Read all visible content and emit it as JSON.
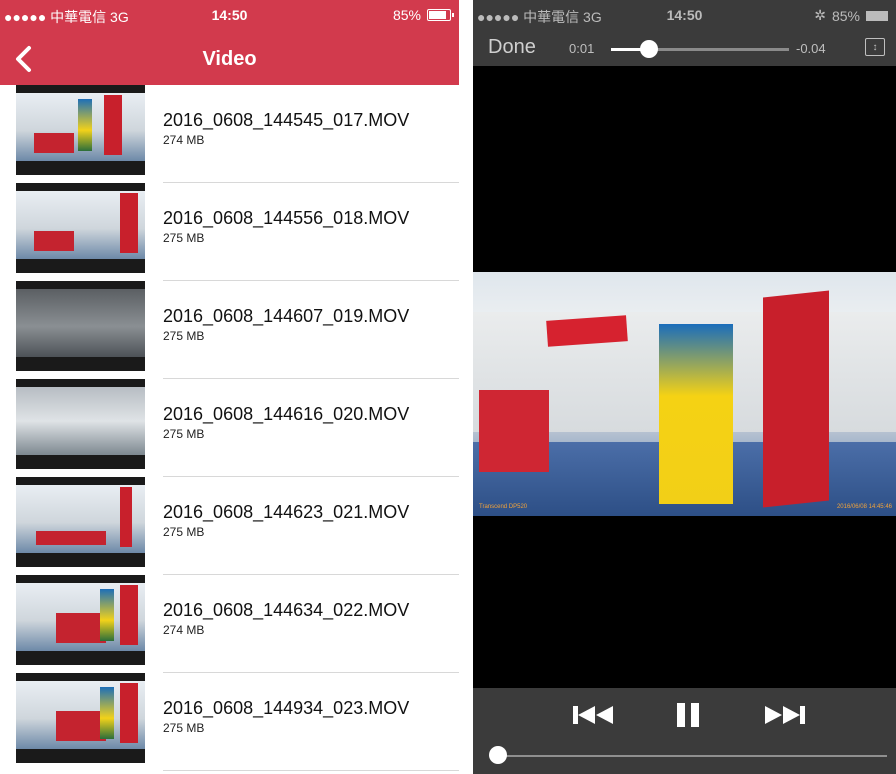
{
  "left": {
    "status_bar": {
      "carrier": "●●●●● 中華電信  3G",
      "time": "14:50",
      "battery": "85%"
    },
    "nav": {
      "title": "Video"
    },
    "videos": [
      {
        "name": "2016_0608_144545_017.MOV",
        "size": "274 MB"
      },
      {
        "name": "2016_0608_144556_018.MOV",
        "size": "275 MB"
      },
      {
        "name": "2016_0608_144607_019.MOV",
        "size": "275 MB"
      },
      {
        "name": "2016_0608_144616_020.MOV",
        "size": "275 MB"
      },
      {
        "name": "2016_0608_144623_021.MOV",
        "size": "275 MB"
      },
      {
        "name": "2016_0608_144634_022.MOV",
        "size": "274 MB"
      },
      {
        "name": "2016_0608_144934_023.MOV",
        "size": "275 MB"
      }
    ]
  },
  "right": {
    "status_bar": {
      "carrier": "●●●●● 中華電信  3G",
      "time": "14:50",
      "battery": "85%"
    },
    "top": {
      "done_label": "Done",
      "elapsed": "0:01",
      "remaining": "-0.04",
      "scrub_progress": 0.2
    },
    "video": {
      "stamp_left": "Transcend DP520",
      "stamp_right": "2016/06/08 14:45:46"
    },
    "controls": {
      "volume_level": 0.02
    },
    "colors": {
      "navbar": "#d23a4d",
      "player_bar": "#3b3b3b"
    }
  }
}
